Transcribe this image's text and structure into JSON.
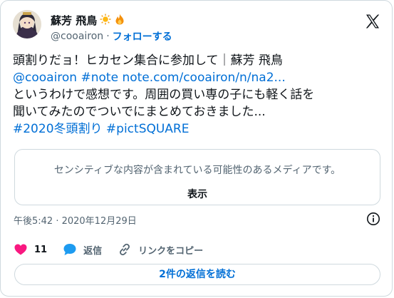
{
  "author": {
    "display_name": "蘇芳 飛鳥",
    "handle": "@cooairon",
    "separator": "·",
    "follow_label": "フォローする"
  },
  "tweet": {
    "line1": "頭割りだョ！ヒカセン集合に参加して｜蘇芳 飛鳥",
    "mention": "@cooairon",
    "hashtag_note": "#note",
    "url": "note.com/cooairon/n/na2...",
    "line3": "というわけで感想です。周囲の買い専の子にも軽く話を",
    "line4": "聞いてみたのでついでにまとめておきました...",
    "hashtag1": "#2020冬頭割り",
    "hashtag2": "#pictSQUARE"
  },
  "sensitive": {
    "warning": "センシティブな内容が含まれている可能性のあるメディアです。",
    "show_label": "表示"
  },
  "timestamp": "午後5:42 · 2020年12月29日",
  "actions": {
    "like_count": "11",
    "reply_label": "返信",
    "copy_link_label": "リンクをコピー"
  },
  "read_replies_label": "2件の返信を読む",
  "colors": {
    "link": "#006fd6",
    "like": "#f91880",
    "reply": "#1d9bf0",
    "muted": "#536471",
    "border": "#cfd9de"
  }
}
